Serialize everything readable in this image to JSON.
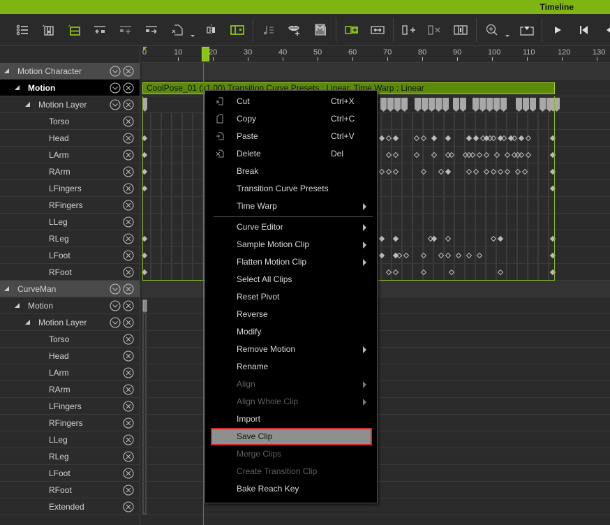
{
  "window": {
    "title": "Timeline"
  },
  "toolbar": {
    "buttons": [
      {
        "name": "track-list-icon",
        "active": false
      },
      {
        "name": "show-selected-track-icon",
        "active": false
      },
      {
        "name": "show-all-tracks-icon",
        "active": true
      },
      {
        "name": "collapse-tracks-left-icon",
        "active": false
      },
      {
        "name": "add-track-icon",
        "active": false
      },
      {
        "name": "expand-tracks-right-icon",
        "active": false
      },
      {
        "name": "key-filter-icon",
        "active": false,
        "dropdown": true
      },
      {
        "name": "split-key-icon",
        "active": false
      },
      {
        "name": "clip-mode-icon",
        "active": true
      },
      {
        "name": "music-track-icon",
        "active": false
      },
      {
        "name": "lips-add-icon",
        "active": false
      },
      {
        "name": "motion-layer-icon",
        "active": false
      },
      {
        "name": "insert-clip-icon",
        "active": true
      },
      {
        "name": "stretch-clip-icon",
        "active": false
      },
      {
        "name": "add-frames-icon",
        "active": false
      },
      {
        "name": "remove-frames-icon",
        "active": false
      },
      {
        "name": "fit-clip-icon",
        "active": false
      },
      {
        "name": "zoom-in-icon",
        "active": false,
        "dropdown": true
      },
      {
        "name": "export-icon",
        "active": false
      },
      {
        "name": "play-icon",
        "active": false
      },
      {
        "name": "go-to-start-icon",
        "active": false
      },
      {
        "name": "previous-icon",
        "active": false
      }
    ]
  },
  "ruler": {
    "ticks": [
      "0",
      "10",
      "20",
      "30",
      "40",
      "50",
      "60",
      "70",
      "80",
      "90",
      "100",
      "110",
      "120",
      "130"
    ],
    "current_frame": 18
  },
  "tree": {
    "groups": [
      {
        "character": "Motion Character",
        "motion": "Motion",
        "layer": "Motion Layer",
        "bones": [
          "Torso",
          "Head",
          "LArm",
          "RArm",
          "LFingers",
          "RFingers",
          "LLeg",
          "RLeg",
          "LFoot",
          "RFoot"
        ]
      },
      {
        "character": "CurveMan",
        "motion": "Motion",
        "layer": "Motion Layer",
        "bones": [
          "Torso",
          "Head",
          "LArm",
          "RArm",
          "LFingers",
          "RFingers",
          "LLeg",
          "RLeg",
          "LFoot",
          "RFoot",
          "Extended"
        ]
      }
    ]
  },
  "clip": {
    "label": "CoolPose_01 (x1.00) Transition Curve Presets : Linear, Time Warp : Linear"
  },
  "context_menu": {
    "items": [
      {
        "label": "Cut",
        "shortcut": "Ctrl+X",
        "icon": "cut-icon"
      },
      {
        "label": "Copy",
        "shortcut": "Ctrl+C",
        "icon": "copy-icon"
      },
      {
        "label": "Paste",
        "shortcut": "Ctrl+V",
        "icon": "paste-icon"
      },
      {
        "label": "Delete",
        "shortcut": "Del",
        "icon": "delete-icon"
      },
      {
        "label": "Break"
      },
      {
        "label": "Transition Curve Presets"
      },
      {
        "label": "Time Warp",
        "submenu": true
      },
      {
        "separator": true
      },
      {
        "label": "Curve Editor",
        "submenu": true
      },
      {
        "label": "Sample Motion Clip",
        "submenu": true
      },
      {
        "label": "Flatten Motion Clip",
        "submenu": true
      },
      {
        "label": "Select All Clips"
      },
      {
        "label": "Reset Pivot"
      },
      {
        "label": "Reverse"
      },
      {
        "label": "Modify"
      },
      {
        "label": "Remove Motion",
        "submenu": true
      },
      {
        "label": "Rename"
      },
      {
        "label": "Align",
        "submenu": true,
        "disabled": true
      },
      {
        "label": "Align Whole Clip",
        "submenu": true,
        "disabled": true
      },
      {
        "label": "Import"
      },
      {
        "label": "Save Clip",
        "highlighted": true
      },
      {
        "label": "Merge Clips",
        "disabled": true
      },
      {
        "label": "Create Transition Clip",
        "disabled": true
      },
      {
        "label": "Bake Reach Key"
      }
    ]
  },
  "colors": {
    "accent": "#7fb512",
    "clip": "#5c8b0a",
    "highlight_border": "#d42a2a"
  }
}
